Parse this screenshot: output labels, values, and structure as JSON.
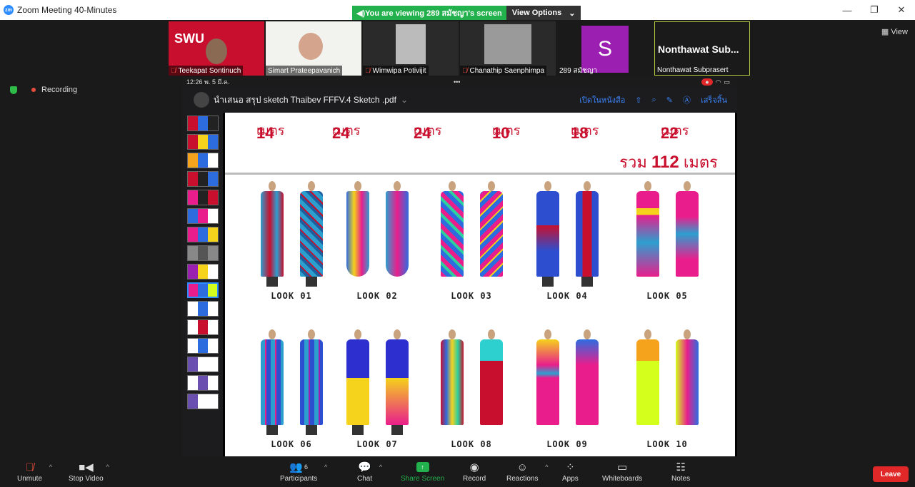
{
  "window": {
    "title": "Zoom Meeting 40-Minutes",
    "controls": [
      "—",
      "❐",
      "✕"
    ]
  },
  "banner": {
    "viewing": "You are viewing 289 สมัชญา's screen",
    "view_options": "View Options"
  },
  "participants_strip": [
    {
      "name": "Teekapat Sontinuch"
    },
    {
      "name": "Simart Prateepavanich"
    },
    {
      "name": "Wimwipa Potivijit"
    },
    {
      "name": "Chanathip Saenphimpa"
    },
    {
      "name": "289 สมัชญา",
      "initial": "S"
    },
    {
      "name": "Nonthawat Subprasert",
      "display": "Nonthawat Sub..."
    }
  ],
  "view_button": "View",
  "recording": "Recording",
  "ipad": {
    "time": "12:26  พ. 5 มี.ค.",
    "dots": "•••"
  },
  "pdf": {
    "title": "นำเสนอ สรุป sketch Thaibev FFFV.4 Sketch .pdf",
    "open_in": "เปิดในหนังสือ",
    "done": "เสร็จสิ้น"
  },
  "meters": [
    {
      "num": "14",
      "unit": "เมตร"
    },
    {
      "num": "24",
      "unit": "เมตร"
    },
    {
      "num": "24",
      "unit": "เมตร"
    },
    {
      "num": "10",
      "unit": "เมตร"
    },
    {
      "num": "18",
      "unit": "เมตร"
    },
    {
      "num": "22",
      "unit": "เมตร"
    }
  ],
  "total": {
    "label": "รวม",
    "value": "112",
    "unit": "เมตร"
  },
  "looks": [
    "LOOK 01",
    "LOOK 02",
    "LOOK 03",
    "LOOK 04",
    "LOOK 05",
    "LOOK 06",
    "LOOK 07",
    "LOOK 08",
    "LOOK 09",
    "LOOK 10"
  ],
  "toolbar": {
    "unmute": "Unmute",
    "stop_video": "Stop Video",
    "participants": "Participants",
    "participants_count": "6",
    "chat": "Chat",
    "share_screen": "Share Screen",
    "record": "Record",
    "reactions": "Reactions",
    "apps": "Apps",
    "whiteboards": "Whiteboards",
    "notes": "Notes",
    "leave": "Leave"
  },
  "colors": {
    "accent_green": "#23b14d",
    "leave_red": "#e02828",
    "meter_red": "#c8102e",
    "avatar_purple": "#9b1fb1"
  }
}
